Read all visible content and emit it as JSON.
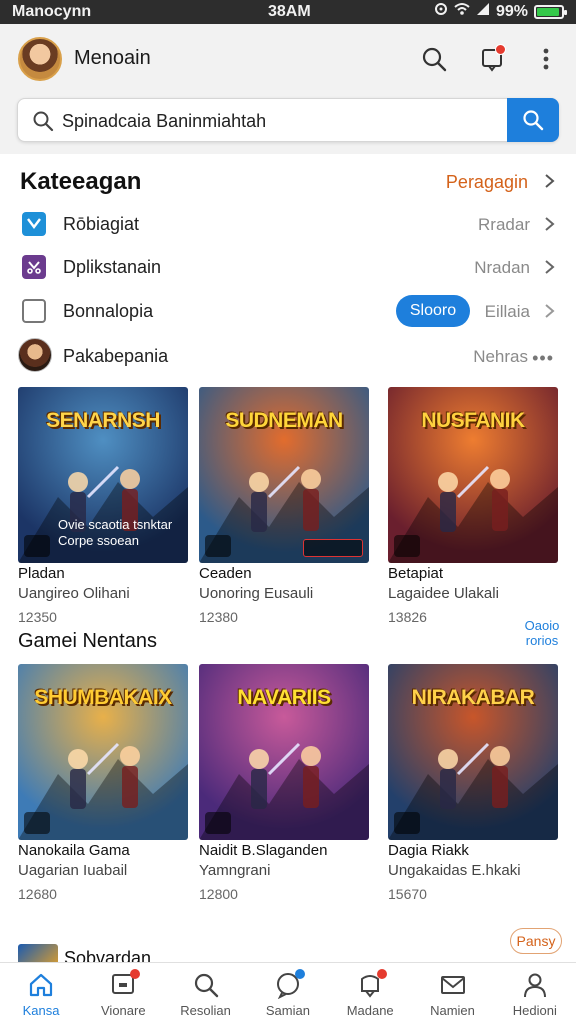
{
  "status_bar": {
    "carrier": "Manocynn",
    "time": "38AM",
    "battery_text": "99%",
    "battery_level": 0.9
  },
  "header": {
    "title": "Menoain",
    "search": {
      "value": "Spinadcaia Baninmiahtah",
      "placeholder": ""
    }
  },
  "categories": {
    "title": "Kateeagan",
    "see_all": "Peragagin",
    "rows": [
      {
        "label": "Rōbiagiat",
        "value": "Rradar",
        "icon": "check-square-icon",
        "color": "#1e90d8"
      },
      {
        "label": "Dplikstanain",
        "value": "Nradan",
        "icon": "scissors-icon",
        "color": "#6b3b8e"
      },
      {
        "label": "Bonnalopia",
        "value": "Eillaia",
        "button": "Slooro",
        "icon": "empty-checkbox-icon"
      },
      {
        "label": "Pakabepania",
        "value": "Nehras"
      }
    ]
  },
  "featured": [
    {
      "art_title": "SENARNSH",
      "name": "Pladan",
      "sub": "Uangireo Olihani",
      "count": "12350",
      "overlay": "Ovie scaotia tsnktar Corpe ssoean",
      "color1": "#1c3566",
      "color2": "#4f8fc2",
      "title_color": "#ffd54a"
    },
    {
      "art_title": "SUDNEMAN",
      "name": "Ceaden",
      "sub": "Uonoring Eusauli",
      "count": "12380",
      "tag": true,
      "color1": "#2c5a8a",
      "color2": "#e26c2d",
      "title_color": "#ffd53a"
    },
    {
      "art_title": "NUSFANIK",
      "name": "Betapiat",
      "sub": "Lagaidee Ulakali",
      "count": "13826",
      "color1": "#6a1f2e",
      "color2": "#ee7d30",
      "title_color": "#ffd23f"
    }
  ],
  "side_link": "Oaoio rorios",
  "games_heading": "Gamei Nentans",
  "games": [
    {
      "art_title": "SHUMBAKAIX",
      "name": "Nanokaila Gama",
      "sub": "Uagarian Iuabail",
      "count": "12680",
      "color1": "#3e7bb6",
      "color2": "#e8b04a",
      "title_color": "#ffcc33"
    },
    {
      "art_title": "NAVARIIS",
      "name": "Naidit B.Slaganden",
      "sub": "Yamngrani",
      "count": "12800",
      "color1": "#4b2a7a",
      "color2": "#c85a9a",
      "title_color": "#ffe033"
    },
    {
      "art_title": "NIRAKABAR",
      "name": "Dagia Riakk",
      "sub": "Ungakaidas E.hkaki",
      "count": "15670",
      "color1": "#23406b",
      "color2": "#c8562a",
      "title_color": "#ffd14a"
    }
  ],
  "peek": {
    "label": "Sobvardan",
    "pill": "Pansy"
  },
  "bottom_nav": [
    {
      "label": "Kansa",
      "icon": "home-icon",
      "active": true
    },
    {
      "label": "Vionare",
      "icon": "chat-box-icon",
      "badge": "red"
    },
    {
      "label": "Resolian",
      "icon": "search-icon"
    },
    {
      "label": "Samian",
      "icon": "chat-bubble-icon",
      "badge": "blue"
    },
    {
      "label": "Madane",
      "icon": "notification-icon",
      "badge": "red"
    },
    {
      "label": "Namien",
      "icon": "mail-icon"
    },
    {
      "label": "Hedioni",
      "icon": "user-icon"
    }
  ]
}
